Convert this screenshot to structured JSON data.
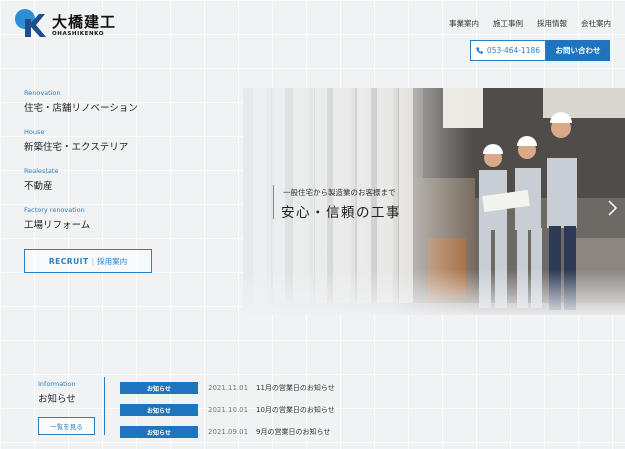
{
  "logo": {
    "jp": "大橋建工",
    "en": "OHASHIKENKO"
  },
  "nav": [
    "事業案内",
    "施工事例",
    "採用情報",
    "会社案内"
  ],
  "header": {
    "phone": "053-464-1186",
    "contact": "お問い合わせ"
  },
  "services": [
    {
      "en": "Renovation",
      "jp": "住宅・店舗リノベーション"
    },
    {
      "en": "House",
      "jp": "新築住宅・エクステリア"
    },
    {
      "en": "Realestate",
      "jp": "不動産"
    },
    {
      "en": "Factory renovation",
      "jp": "工場リフォーム"
    }
  ],
  "recruit": {
    "en": "RECRUIT",
    "jp": "採用案内"
  },
  "hero": {
    "sub": "一般住宅から製造業のお客様まで",
    "main": "安心・信頼の工事"
  },
  "info": {
    "en": "Information",
    "jp": "お知らせ",
    "list_button": "一覧を見る",
    "items": [
      {
        "badge": "お知らせ",
        "date": "2021.11.01",
        "title": "11月の営業日のお知らせ"
      },
      {
        "badge": "お知らせ",
        "date": "2021.10.01",
        "title": "10月の営業日のお知らせ"
      },
      {
        "badge": "お知らせ",
        "date": "2021.09.01",
        "title": "9月の営業日のお知らせ"
      }
    ]
  },
  "colors": {
    "accent": "#1f74c0",
    "accent_light": "#2b7fc4",
    "background": "#f1f2f4"
  },
  "icons": [
    "logo-mark-icon",
    "phone-icon",
    "chevron-right-icon"
  ]
}
